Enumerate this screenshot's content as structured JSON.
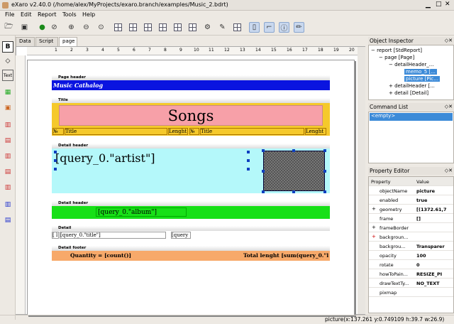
{
  "window": {
    "title": "eXaro v2.40.0 (/home/alex/MyProjects/exaro.branch/examples/Music_2.bdrt)"
  },
  "menu": [
    "File",
    "Edit",
    "Report",
    "Tools",
    "Help"
  ],
  "tabs": [
    "Data",
    "Script",
    "page"
  ],
  "ruler": [
    "1",
    "2",
    "3",
    "4",
    "5",
    "6",
    "7",
    "8",
    "9",
    "10",
    "11",
    "12",
    "13",
    "14",
    "15",
    "16",
    "17",
    "18",
    "19",
    "20",
    "21"
  ],
  "bands": {
    "page_header": {
      "label": "Page header",
      "text": "Music Cathalog"
    },
    "title": {
      "label": "Title",
      "heading": "Songs",
      "cols": [
        "№",
        "Title",
        "Lenght",
        "№",
        "Title",
        "Lenght"
      ]
    },
    "detail_header1": {
      "label": "Detail header",
      "text": "[query_0.\"artist\"]"
    },
    "detail_header2": {
      "label": "Detail header",
      "text": "[query_0.\"album\"]"
    },
    "detail": {
      "label": "Detail",
      "c1": "[ l",
      "c2": "[query_0.\"title\"]",
      "c3": "[query"
    },
    "detail_footer": {
      "label": "Detail footer",
      "qty": "Quantity = [count()]",
      "total": "Total lenght [sum(query_0.\"le"
    }
  },
  "object_inspector": {
    "title": "Object Inspector",
    "items": [
      "report [StdReport]",
      "page [Page]",
      "detailHeader_...",
      "memo_5 [...",
      "picture [Pic...",
      "detailHeader [...",
      "detail [Detail]"
    ]
  },
  "command_list": {
    "title": "Command List",
    "item": "<empty>"
  },
  "property_editor": {
    "title": "Property Editor",
    "col_property": "Property",
    "col_value": "Value",
    "rows": [
      {
        "n": "objectName",
        "v": "picture",
        "p": ""
      },
      {
        "n": "enabled",
        "v": "true",
        "p": ""
      },
      {
        "n": "geometry",
        "v": "[(1372.61,7",
        "p": "+"
      },
      {
        "n": "frame",
        "v": "[]",
        "p": ""
      },
      {
        "n": "frameBorder",
        "v": "",
        "p": "+"
      },
      {
        "n": "backgroun...",
        "v": "",
        "p": "+"
      },
      {
        "n": "backgrou...",
        "v": "Transparer",
        "p": ""
      },
      {
        "n": "opacity",
        "v": "100",
        "p": ""
      },
      {
        "n": "rotate",
        "v": "0",
        "p": ""
      },
      {
        "n": "howToPain...",
        "v": "RESIZE_PI",
        "p": ""
      },
      {
        "n": "drawTextTy...",
        "v": "NO_TEXT",
        "p": ""
      },
      {
        "n": "pixmap",
        "v": "",
        "p": ""
      }
    ]
  },
  "status": {
    "text": "picture(x:137.261 y:0.749109 h:39.7 w:26.9)"
  },
  "colors": {
    "page_header": "#0a14e0",
    "title": "#f5c92b",
    "title_inner": "#f7a0a8",
    "detail_header": "#b4f8fa",
    "album": "#17e017",
    "footer": "#f7a96a",
    "selection": "#3d8bd8"
  }
}
